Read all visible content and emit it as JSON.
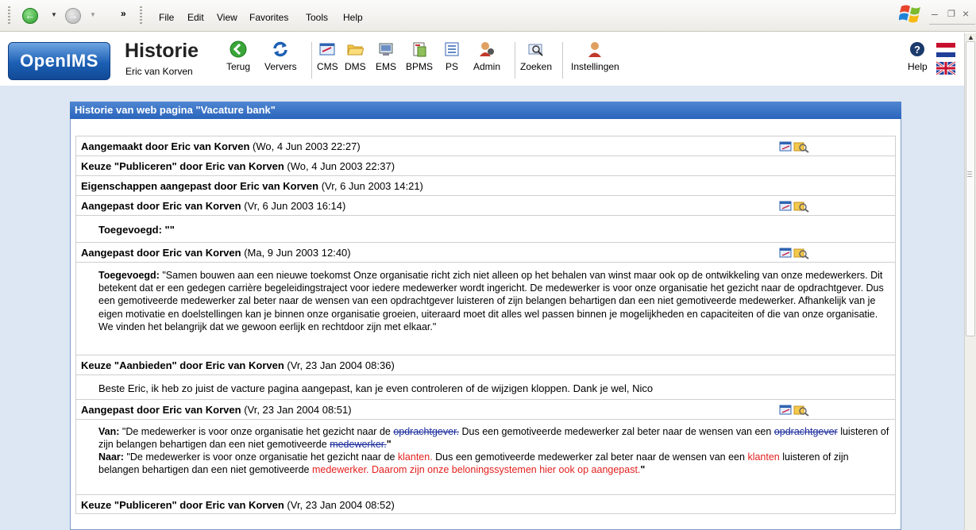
{
  "browser": {
    "menu": [
      "File",
      "Edit",
      "View",
      "Favorites",
      "Tools",
      "Help"
    ],
    "window_controls": [
      "–",
      "×"
    ]
  },
  "app": {
    "logo_text": "OpenIMS",
    "page_title": "Historie",
    "user": "Eric van Korven",
    "toolbar": [
      {
        "label": "Terug",
        "icon": "back-arrow-icon"
      },
      {
        "label": "Ververs",
        "icon": "refresh-icon"
      },
      {
        "label": "CMS",
        "icon": "cms-icon"
      },
      {
        "label": "DMS",
        "icon": "folder-icon"
      },
      {
        "label": "EMS",
        "icon": "ems-icon"
      },
      {
        "label": "BPMS",
        "icon": "bpms-icon"
      },
      {
        "label": "PS",
        "icon": "ps-icon"
      },
      {
        "label": "Admin",
        "icon": "admin-icon"
      },
      {
        "label": "Zoeken",
        "icon": "search-icon"
      },
      {
        "label": "Instellingen",
        "icon": "settings-person-icon"
      }
    ],
    "help_label": "Help"
  },
  "panel": {
    "title": "Historie van web pagina \"Vacature bank\""
  },
  "history": {
    "r1": {
      "action": "Aangemaakt door Eric van Korven",
      "date": "(Wo, 4 Jun 2003 22:27)"
    },
    "r2": {
      "action": "Keuze \"Publiceren\" door Eric van Korven",
      "date": "(Wo, 4 Jun 2003 22:37)"
    },
    "r3": {
      "action": "Eigenschappen aangepast door Eric van Korven",
      "date": "(Vr, 6 Jun 2003 14:21)"
    },
    "r4": {
      "action": "Aangepast door Eric van Korven",
      "date": "(Vr, 6 Jun 2003 16:14)"
    },
    "r4_body": "Toegevoegd: \"\"",
    "r5": {
      "action": "Aangepast door Eric van Korven",
      "date": "(Ma, 9 Jun 2003 12:40)"
    },
    "r5_body_label": "Toegevoegd:",
    "r5_body_text": "\"Samen bouwen aan een nieuwe toekomst Onze organisatie richt zich niet alleen op het behalen van winst maar ook op de ontwikkeling van onze medewerkers.  Dit betekent dat er een gedegen carrière begeleidingstraject voor iedere medewerker wordt ingericht.  De medewerker is voor onze organisatie het gezicht naar de opdrachtgever.  Dus een gemotiveerde medewerker zal beter naar de wensen van een opdrachtgever luisteren of zijn belangen behartigen dan een niet gemotiveerde medewerker.  Afhankelijk van je eigen motivatie en doelstellingen kan je binnen onze organisatie groeien,  uiteraard moet dit alles wel passen binnen je mogelijkheden en capaciteiten of die van onze organisatie.  We vinden het belangrijk dat we gewoon eerlijk en rechtdoor zijn met elkaar.\"",
    "r6": {
      "action": "Keuze \"Aanbieden\" door Eric van Korven",
      "date": "(Vr, 23 Jan 2004 08:36)"
    },
    "r6_body": "Beste Eric, ik heb zo juist de vacture pagina aangepast, kan je even controleren of de wijzigen kloppen. Dank je wel, Nico",
    "r7": {
      "action": "Aangepast door Eric van Korven",
      "date": "(Vr, 23 Jan 2004 08:51)"
    },
    "r7_van_label": "Van:",
    "r7_van_1": "\"De medewerker is voor onze organisatie het gezicht naar de ",
    "r7_van_del1": "opdrachtgever.",
    "r7_van_2": "  Dus een gemotiveerde medewerker zal beter naar de wensen van een ",
    "r7_van_del2": "opdrachtgever",
    "r7_van_3": " luisteren of zijn belangen behartigen dan een niet gemotiveerde ",
    "r7_van_del3": "medewerker.",
    "r7_van_4": "\"",
    "r7_naar_label": "Naar:",
    "r7_naar_1": "\"De medewerker is voor onze organisatie het gezicht naar de ",
    "r7_naar_add1": "klanten.",
    "r7_naar_2": "  Dus een gemotiveerde medewerker zal beter naar de wensen van een ",
    "r7_naar_add2": "klanten",
    "r7_naar_3": " luisteren of zijn belangen behartigen dan een niet gemotiveerde ",
    "r7_naar_add3": "medewerker.  Daarom zijn onze beloningssystemen hier ook op aangepast.",
    "r7_naar_4": "\"",
    "r8": {
      "action": "Keuze \"Publiceren\" door Eric van Korven",
      "date": "(Vr, 23 Jan 2004 08:52)"
    }
  }
}
